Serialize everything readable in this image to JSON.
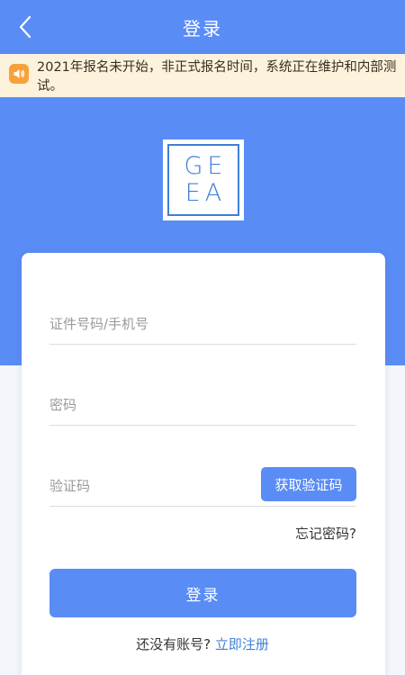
{
  "header": {
    "title": "登录",
    "back_icon": "chevron-left-icon",
    "background": "#5a8cf5"
  },
  "notice": {
    "icon": "speaker-icon",
    "text": "2021年报名未开始，非正式报名时间，系统正在维护和内部测试。"
  },
  "logo": {
    "line1": "GE",
    "line2": "EA"
  },
  "form": {
    "id_placeholder": "证件号码/手机号",
    "password_placeholder": "密码",
    "code_placeholder": "验证码",
    "get_code_label": "获取验证码",
    "forgot_label": "忘记密码?",
    "login_label": "登录",
    "no_account_text": "还没有账号?",
    "register_label": "立即注册"
  },
  "colors": {
    "primary": "#5a8cf5",
    "notice_bg": "#fdf2dc",
    "notice_icon": "#f7a13b",
    "link": "#3f7fd6"
  }
}
